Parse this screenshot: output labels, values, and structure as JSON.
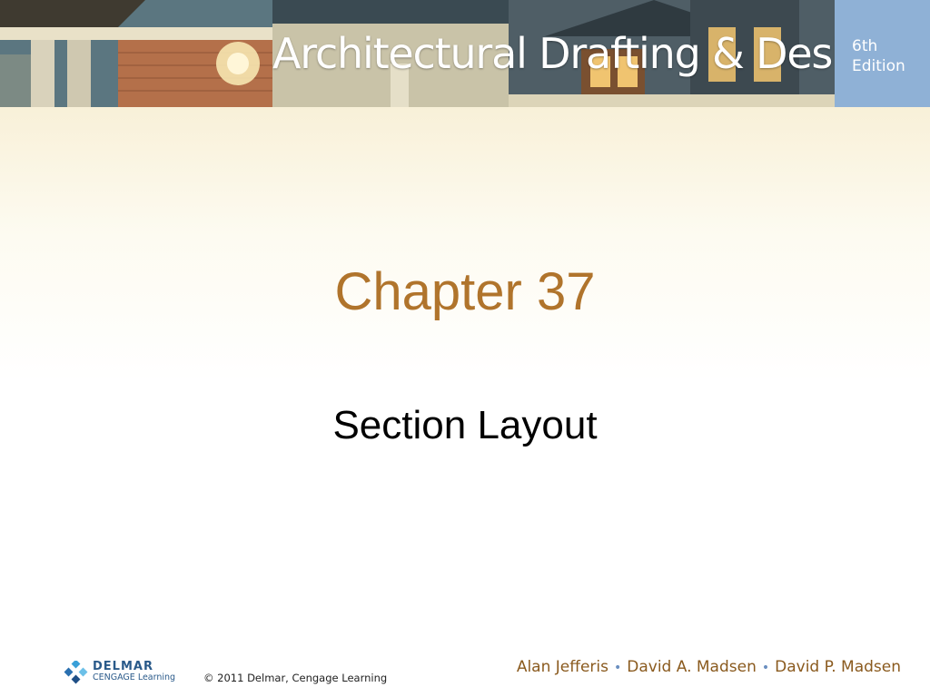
{
  "header": {
    "title": "Architectural Drafting & Design",
    "edition_line1": "6th",
    "edition_line2": "Edition"
  },
  "slide": {
    "chapter": "Chapter 37",
    "section": "Section Layout"
  },
  "footer": {
    "logo_line1": "DELMAR",
    "logo_line2": "CENGAGE Learning",
    "copyright": "© 2011  Delmar, Cengage Learning",
    "authors": [
      "Alan Jefferis",
      "David A. Madsen",
      "David P. Madsen"
    ],
    "separator": "•"
  },
  "colors": {
    "chapter": "#b0742c",
    "edition_box": "#8fb1d6",
    "authors": "#8a5a1e"
  }
}
